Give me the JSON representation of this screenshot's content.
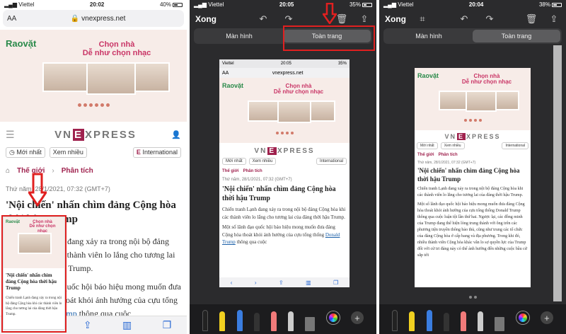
{
  "panel1": {
    "status": {
      "carrier": "Viettel",
      "time": "20:02",
      "battery": "40%"
    },
    "url": {
      "aa": "AA",
      "domain": "vnexpress.net"
    },
    "ad": {
      "logo": "Raovặt",
      "headline_1": "Chọn nhà",
      "headline_2": "Dễ như chọn nhạc"
    },
    "brand": {
      "left": "VN",
      "mid": "E",
      "right": "XPRESS"
    },
    "pills": {
      "latest": "Mới nhất",
      "most": "Xem nhiều",
      "intl": "International"
    },
    "crumb": {
      "cat": "Thế giới",
      "sub": "Phân tích"
    },
    "date": "Thứ năm, 28/1/2021, 07:32 (GMT+7)",
    "title": "'Nội chiến' nhấn chìm đảng Cộng hòa thời hậu Trump",
    "body1": "Chiến tranh Lạnh đang xảy ra trong nội bộ đảng Cộng hòa khi các thành viên lo lắng cho tương lai của đảng thời hậu Trump.",
    "body2_a": "Một số lãnh đạo quốc hội báo hiệu mong muốn đưa đảng Cộng hòa thoát khỏi ảnh hưởng của cựu tổng thống",
    "body2_link": "Donald Trump",
    "body2_b": "thông qua cuộc",
    "toolbar": {
      "back": "‹",
      "fwd": "›",
      "share": "⇪",
      "book": "📖",
      "tabs": "❐"
    }
  },
  "panel2": {
    "status": {
      "carrier": "Viettel",
      "time": "20:05",
      "battery": "35%"
    },
    "done": "Xong",
    "seg": {
      "screen": "Màn hình",
      "full": "Toàn trang"
    },
    "mini": {
      "carrier": "Viettel",
      "time": "20:05",
      "battery": "35%",
      "aa": "AA",
      "domain": "vnexpress.net"
    },
    "body2_b2": "thông qua cuộc"
  },
  "panel3": {
    "status": {
      "carrier": "Viettel",
      "time": "20:04",
      "battery": "38%"
    },
    "done": "Xong",
    "seg": {
      "screen": "Màn hình",
      "full": "Toàn trang"
    },
    "p2": "Một số lãnh đạo quốc hội báo hiệu mong muốn đưa đảng Cộng hòa thoát khỏi ảnh hưởng của cựu tổng thống Donald Trump thông qua cuộc luận tội lần thứ hai. Ngược lại, các đồng minh của Trump đang thể hiện lòng trung thành với ông trên các phương tiện truyền thông bảo thủ, cũng như trung các tổ chức của đảng Cộng hòa ở cấp bang và địa phương. Trong khi đó, nhiều thành viên Cộng hòa khác vẫn lo sợ quyền lực của Trump đối với cử tri đảng này có thể ảnh hưởng đến những cuộc bầu cử sắp tới"
  }
}
